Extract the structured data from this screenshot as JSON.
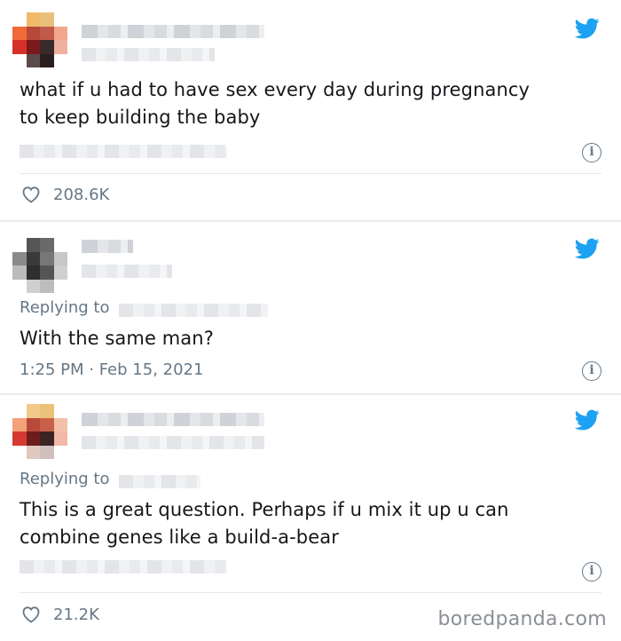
{
  "tweets": [
    {
      "text_lines": [
        "what if u had to have sex every day during pregnancy",
        "to keep building the baby"
      ],
      "likes": "208.6K"
    },
    {
      "replying_to_label": "Replying to",
      "text_lines": [
        "With the same man?"
      ],
      "timestamp": "1:25 PM · Feb 15, 2021"
    },
    {
      "replying_to_label": "Replying to",
      "text_lines": [
        "This is a great question. Perhaps if u mix it up u can",
        "combine genes like a build-a-bear"
      ],
      "likes": "21.2K"
    }
  ],
  "info_icon_glyph": "i",
  "watermark": "boredpanda.com",
  "colors": {
    "twitter_blue": "#1da1f2",
    "secondary_text": "#657786",
    "primary_text": "#14171a"
  }
}
